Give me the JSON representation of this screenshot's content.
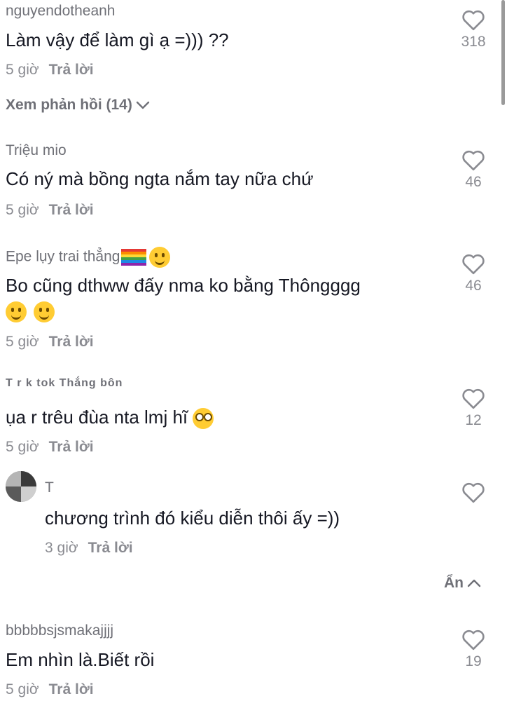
{
  "comments": [
    {
      "username": "nguyendotheanh",
      "text": "Làm vậy để làm gì ạ =))) ??",
      "time": "5 giờ",
      "reply": "Trả lời",
      "likes": "318",
      "view_replies": "Xem phản hồi (14)"
    },
    {
      "username": "Triệu mio",
      "text": "Có ný mà bồng ngta nắm tay nữa chứ",
      "time": "5 giờ",
      "reply": "Trả lời",
      "likes": "46"
    },
    {
      "username": "Epe lụy trai thẳng",
      "text": "Bo cũng dthww đấy nma ko bằng Thôngggg",
      "time": "5 giờ",
      "reply": "Trả lời",
      "likes": "46"
    },
    {
      "username": "T r k tok Thắng bôn",
      "text": "ụa r trêu đùa nta lmj hĩ",
      "time": "5 giờ",
      "reply": "Trả lời",
      "likes": "12"
    },
    {
      "username": "T",
      "text": "chương trình đó kiểu diễn thôi ấy =))",
      "time": "3 giờ",
      "reply": "Trả lời"
    },
    {
      "username": "bbbbbsjsmakajjjj",
      "text": "Em nhìn là.Biết rồi",
      "time": "5 giờ",
      "reply": "Trả lời",
      "likes": "19"
    }
  ],
  "hide_label": "Ẩn",
  "icons": {
    "like": "heart-outline-icon",
    "chevron_down": "chevron-down-icon",
    "chevron_up": "chevron-up-icon"
  }
}
